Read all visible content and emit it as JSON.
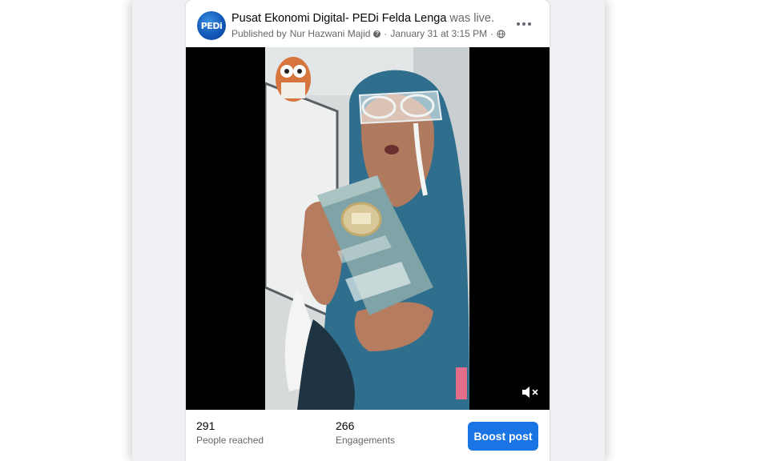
{
  "post": {
    "page_name": "Pusat Ekonomi Digital- PEDi Felda Lenga",
    "status_text": "was live.",
    "published_prefix": "Published by",
    "author": "Nur Hazwani Majid",
    "separator": "·",
    "date": "January 31 at 3:15 PM",
    "avatar_logo": "PEDi",
    "privacy_icon": "globe-icon",
    "more_icon": "more-dots-icon"
  },
  "video": {
    "volume_icon": "volume-muted-icon"
  },
  "stats": {
    "reached_value": "291",
    "reached_label": "People reached",
    "engagements_value": "266",
    "engagements_label": "Engagements"
  },
  "actions": {
    "boost_label": "Boost post"
  },
  "colors": {
    "brand_blue": "#1b74e4",
    "feed_background": "#eef0f3",
    "secondary_text": "#65676b"
  }
}
